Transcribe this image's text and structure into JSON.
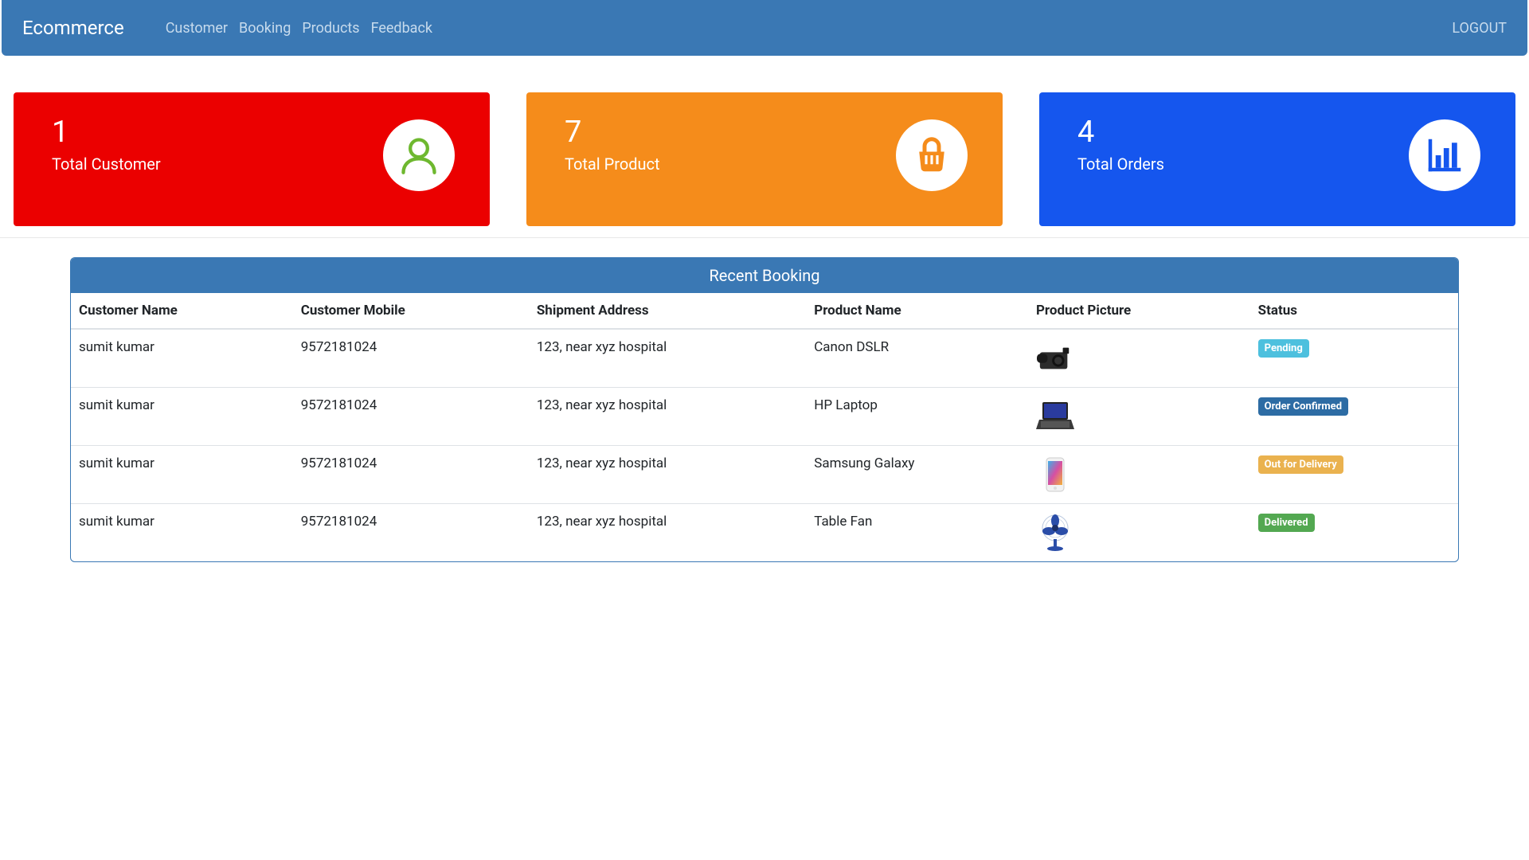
{
  "nav": {
    "brand": "Ecommerce",
    "links": [
      "Customer",
      "Booking",
      "Products",
      "Feedback"
    ],
    "logout": "LOGOUT"
  },
  "cards": [
    {
      "value": "1",
      "label": "Total Customer",
      "icon": "user-icon",
      "color": "red"
    },
    {
      "value": "7",
      "label": "Total Product",
      "icon": "basket-icon",
      "color": "orange"
    },
    {
      "value": "4",
      "label": "Total Orders",
      "icon": "chart-icon",
      "color": "blue"
    }
  ],
  "booking": {
    "title": "Recent Booking",
    "columns": [
      "Customer Name",
      "Customer Mobile",
      "Shipment Address",
      "Product Name",
      "Product Picture",
      "Status"
    ],
    "rows": [
      {
        "name": "sumit kumar",
        "mobile": "9572181024",
        "address": "123, near xyz hospital",
        "product": "Canon DSLR",
        "pic": "camera",
        "status": "Pending",
        "status_class": "info"
      },
      {
        "name": "sumit kumar",
        "mobile": "9572181024",
        "address": "123, near xyz hospital",
        "product": "HP Laptop",
        "pic": "laptop",
        "status": "Order Confirmed",
        "status_class": "primary"
      },
      {
        "name": "sumit kumar",
        "mobile": "9572181024",
        "address": "123, near xyz hospital",
        "product": "Samsung Galaxy",
        "pic": "phone",
        "status": "Out for Delivery",
        "status_class": "warning"
      },
      {
        "name": "sumit kumar",
        "mobile": "9572181024",
        "address": "123, near xyz hospital",
        "product": "Table Fan",
        "pic": "fan",
        "status": "Delivered",
        "status_class": "success"
      }
    ]
  },
  "colors": {
    "navbar": "#3a78b4",
    "card_red": "#eb0000",
    "card_orange": "#f58c1b",
    "card_blue": "#1556ee"
  }
}
